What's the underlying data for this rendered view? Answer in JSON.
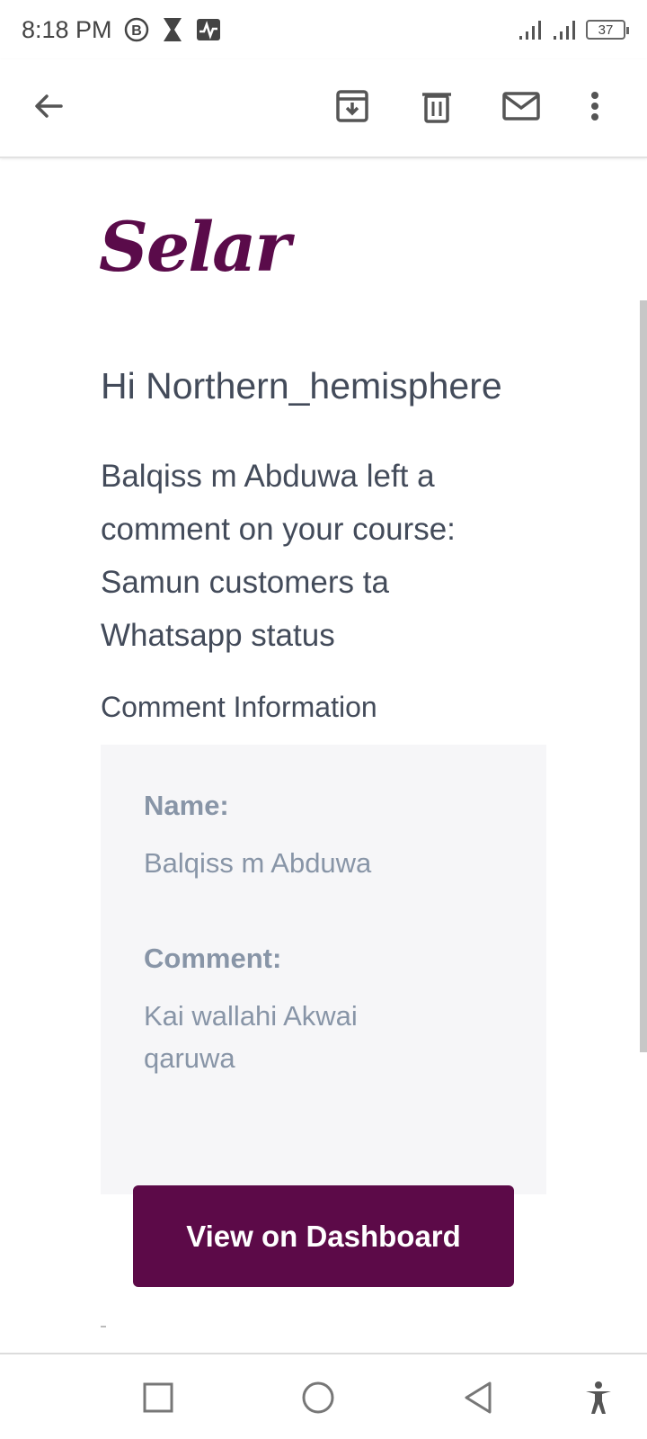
{
  "status_bar": {
    "time": "8:18 PM",
    "battery": "37",
    "icons": [
      "b-circle-icon",
      "hourglass-icon",
      "activity-icon",
      "signal-icon",
      "signal-icon-2",
      "battery-icon"
    ]
  },
  "toolbar": {
    "icons": [
      "back-arrow-icon",
      "archive-icon",
      "delete-icon",
      "mark-unread-icon",
      "more-vert-icon"
    ]
  },
  "email": {
    "brand": "Selar",
    "greeting": "Hi Northern_hemisphere",
    "message": "Balqiss m Abduwa left a comment on your course: Samun customers ta Whatsapp status",
    "section_title": "Comment Information",
    "name_label": "Name:",
    "name_value": "Balqiss m Abduwa",
    "comment_label": "Comment:",
    "comment_value": "Kai wallahi Akwai qaruwa",
    "button_label": "View on Dashboard",
    "brand_color": "#5c0a48"
  },
  "nav_bar": {
    "icons": [
      "recents-square-icon",
      "home-circle-icon",
      "back-triangle-icon",
      "accessibility-icon"
    ]
  }
}
